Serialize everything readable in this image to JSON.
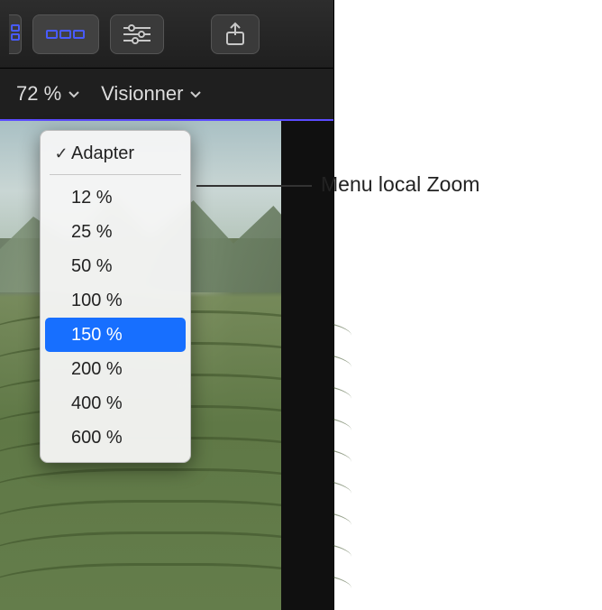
{
  "toolbar": {
    "zoom_value": "72 %",
    "view_label": "Visionner"
  },
  "zoom_menu": {
    "fit_label": "Adapter",
    "options": {
      "o0": "12 %",
      "o1": "25 %",
      "o2": "50 %",
      "o3": "100 %",
      "o4": "150 %",
      "o5": "200 %",
      "o6": "400 %",
      "o7": "600 %"
    }
  },
  "callout": {
    "label": "Menu local Zoom"
  }
}
